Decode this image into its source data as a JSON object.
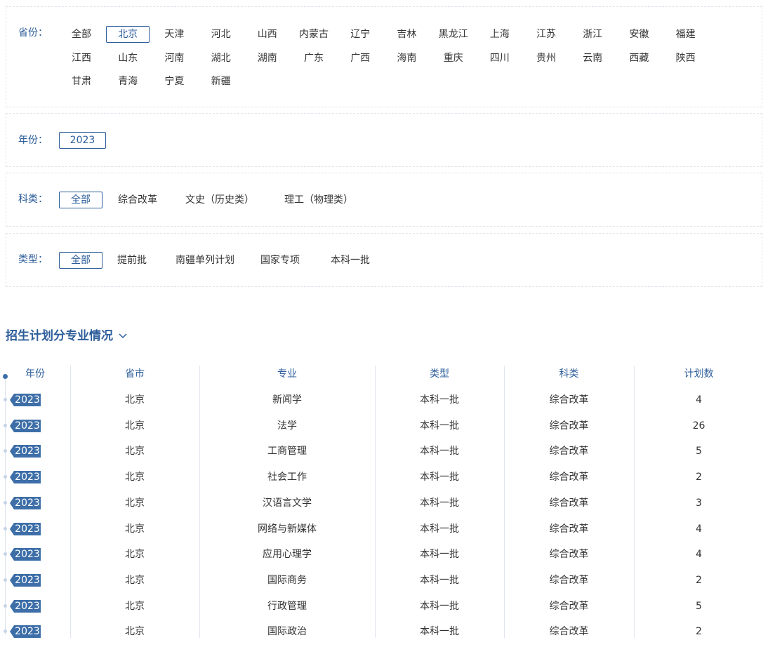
{
  "filters": {
    "province": {
      "label": "省份：",
      "options": [
        "全部",
        "北京",
        "天津",
        "河北",
        "山西",
        "内蒙古",
        "辽宁",
        "吉林",
        "黑龙江",
        "上海",
        "江苏",
        "浙江",
        "安徽",
        "福建",
        "江西",
        "山东",
        "河南",
        "湖北",
        "湖南",
        "广东",
        "广西",
        "海南",
        "重庆",
        "四川",
        "贵州",
        "云南",
        "西藏",
        "陕西",
        "甘肃",
        "青海",
        "宁夏",
        "新疆"
      ],
      "selected": "北京"
    },
    "year": {
      "label": "年份：",
      "options": [
        "2023"
      ],
      "selected": "2023"
    },
    "subject": {
      "label": "科类：",
      "options": [
        "全部",
        "综合改革",
        "文史（历史类）",
        "理工（物理类）"
      ],
      "selected": "全部"
    },
    "type": {
      "label": "类型：",
      "options": [
        "全部",
        "提前批",
        "南疆单列计划",
        "国家专项",
        "本科一批"
      ],
      "selected": "全部"
    }
  },
  "section": {
    "title": "招生计划分专业情况",
    "collapse_icon": "chevron-down-icon"
  },
  "table": {
    "headers": [
      "年份",
      "省市",
      "专业",
      "类型",
      "科类",
      "计划数"
    ],
    "rows": [
      [
        "2023",
        "北京",
        "新闻学",
        "本科一批",
        "综合改革",
        "4"
      ],
      [
        "2023",
        "北京",
        "法学",
        "本科一批",
        "综合改革",
        "26"
      ],
      [
        "2023",
        "北京",
        "工商管理",
        "本科一批",
        "综合改革",
        "5"
      ],
      [
        "2023",
        "北京",
        "社会工作",
        "本科一批",
        "综合改革",
        "2"
      ],
      [
        "2023",
        "北京",
        "汉语言文学",
        "本科一批",
        "综合改革",
        "3"
      ],
      [
        "2023",
        "北京",
        "网络与新媒体",
        "本科一批",
        "综合改革",
        "4"
      ],
      [
        "2023",
        "北京",
        "应用心理学",
        "本科一批",
        "综合改革",
        "4"
      ],
      [
        "2023",
        "北京",
        "国际商务",
        "本科一批",
        "综合改革",
        "2"
      ],
      [
        "2023",
        "北京",
        "行政管理",
        "本科一批",
        "综合改革",
        "5"
      ],
      [
        "2023",
        "北京",
        "国际政治",
        "本科一批",
        "综合改革",
        "2"
      ]
    ]
  },
  "colors": {
    "accent": "#2d5d9a",
    "tag": "#3d6ea8",
    "border": "#dde3ea"
  }
}
